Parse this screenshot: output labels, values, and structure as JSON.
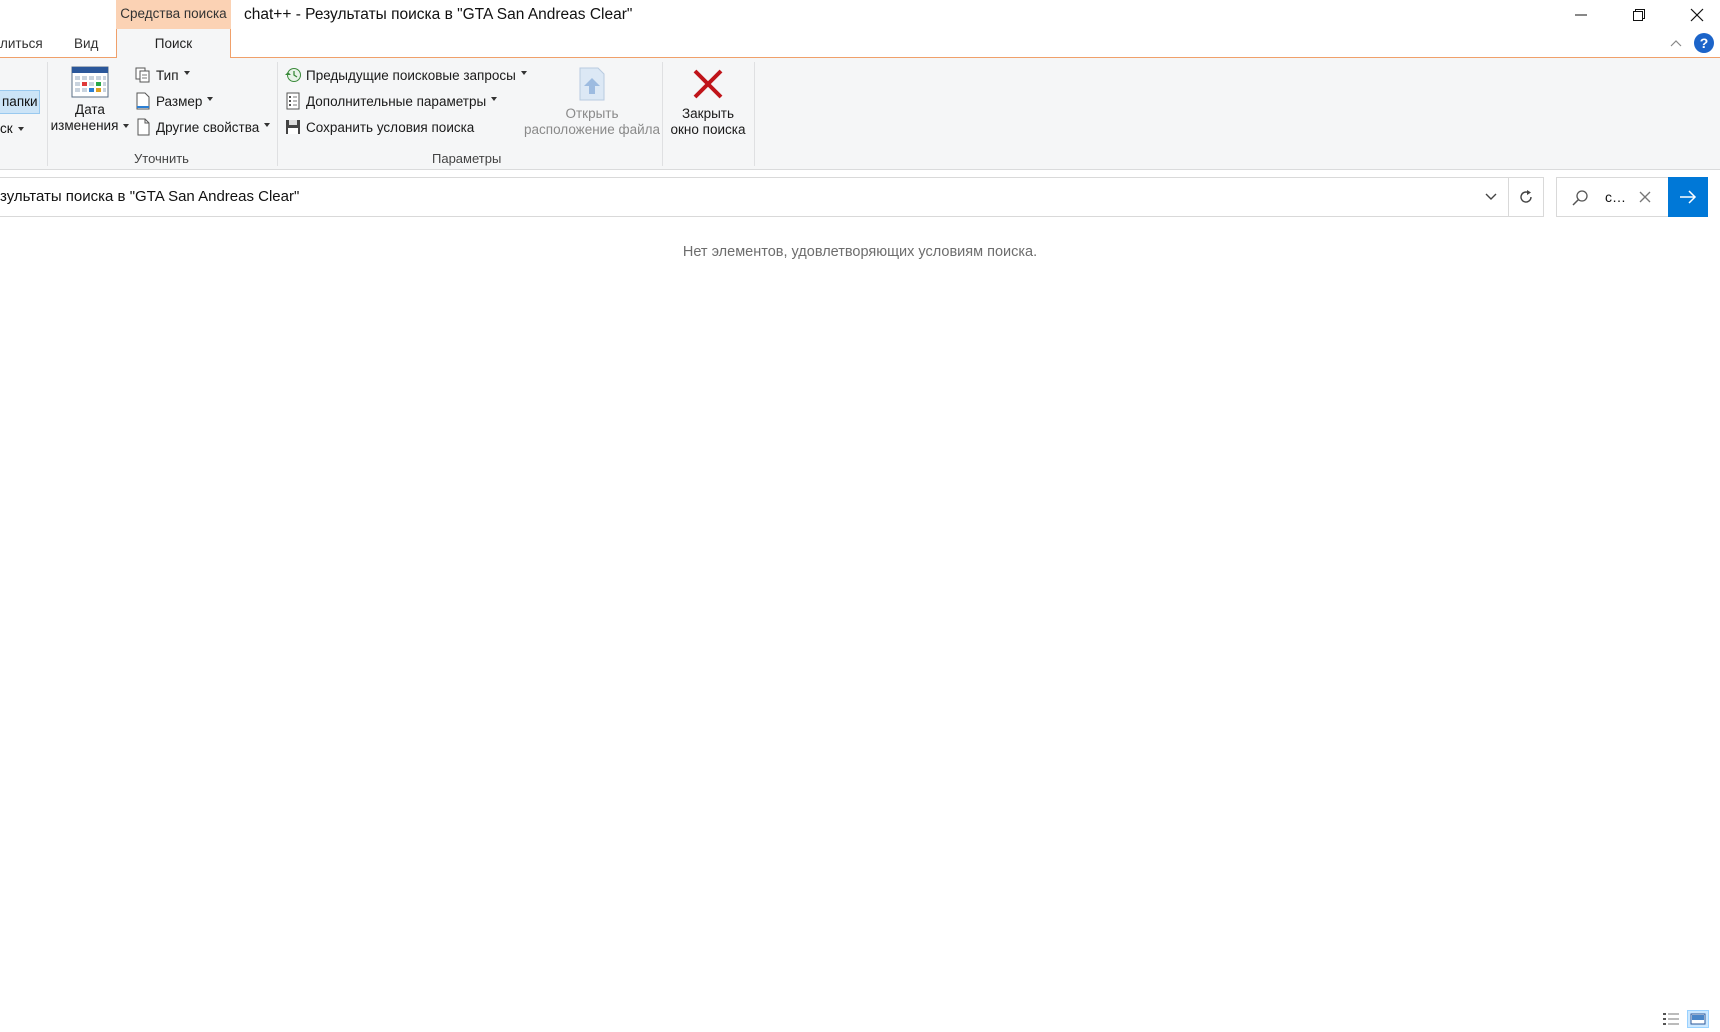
{
  "window": {
    "context_tab_title": "Средства поиска",
    "title": "chat++ - Результаты поиска в \"GTA San Andreas Clear\""
  },
  "tabs": {
    "share_partial": "литься",
    "view": "Вид",
    "search": "Поиск"
  },
  "ribbon": {
    "partial_folder_btn": "папки",
    "partial_ck_btn": "ск",
    "refine": {
      "group_label": "Уточнить",
      "date_modified_line1": "Дата",
      "date_modified_line2": "изменения",
      "type": "Тип",
      "size": "Размер",
      "other_properties": "Другие свойства"
    },
    "options": {
      "group_label": "Параметры",
      "recent_searches": "Предыдущие поисковые запросы",
      "advanced_options": "Дополнительные параметры",
      "save_search": "Сохранить условия поиска",
      "open_location_line1": "Открыть",
      "open_location_line2": "расположение файла"
    },
    "close": {
      "close_search_line1": "Закрыть",
      "close_search_line2": "окно поиска"
    }
  },
  "address": {
    "path": "зультаты поиска в \"GTA San Andreas Clear\""
  },
  "search": {
    "value": "chat++"
  },
  "content": {
    "empty_message": "Нет элементов, удовлетворяющих условиям поиска."
  },
  "colors": {
    "accent": "#0078d7",
    "context_tab": "#fbd2b4",
    "close_x": "#c0141a"
  }
}
